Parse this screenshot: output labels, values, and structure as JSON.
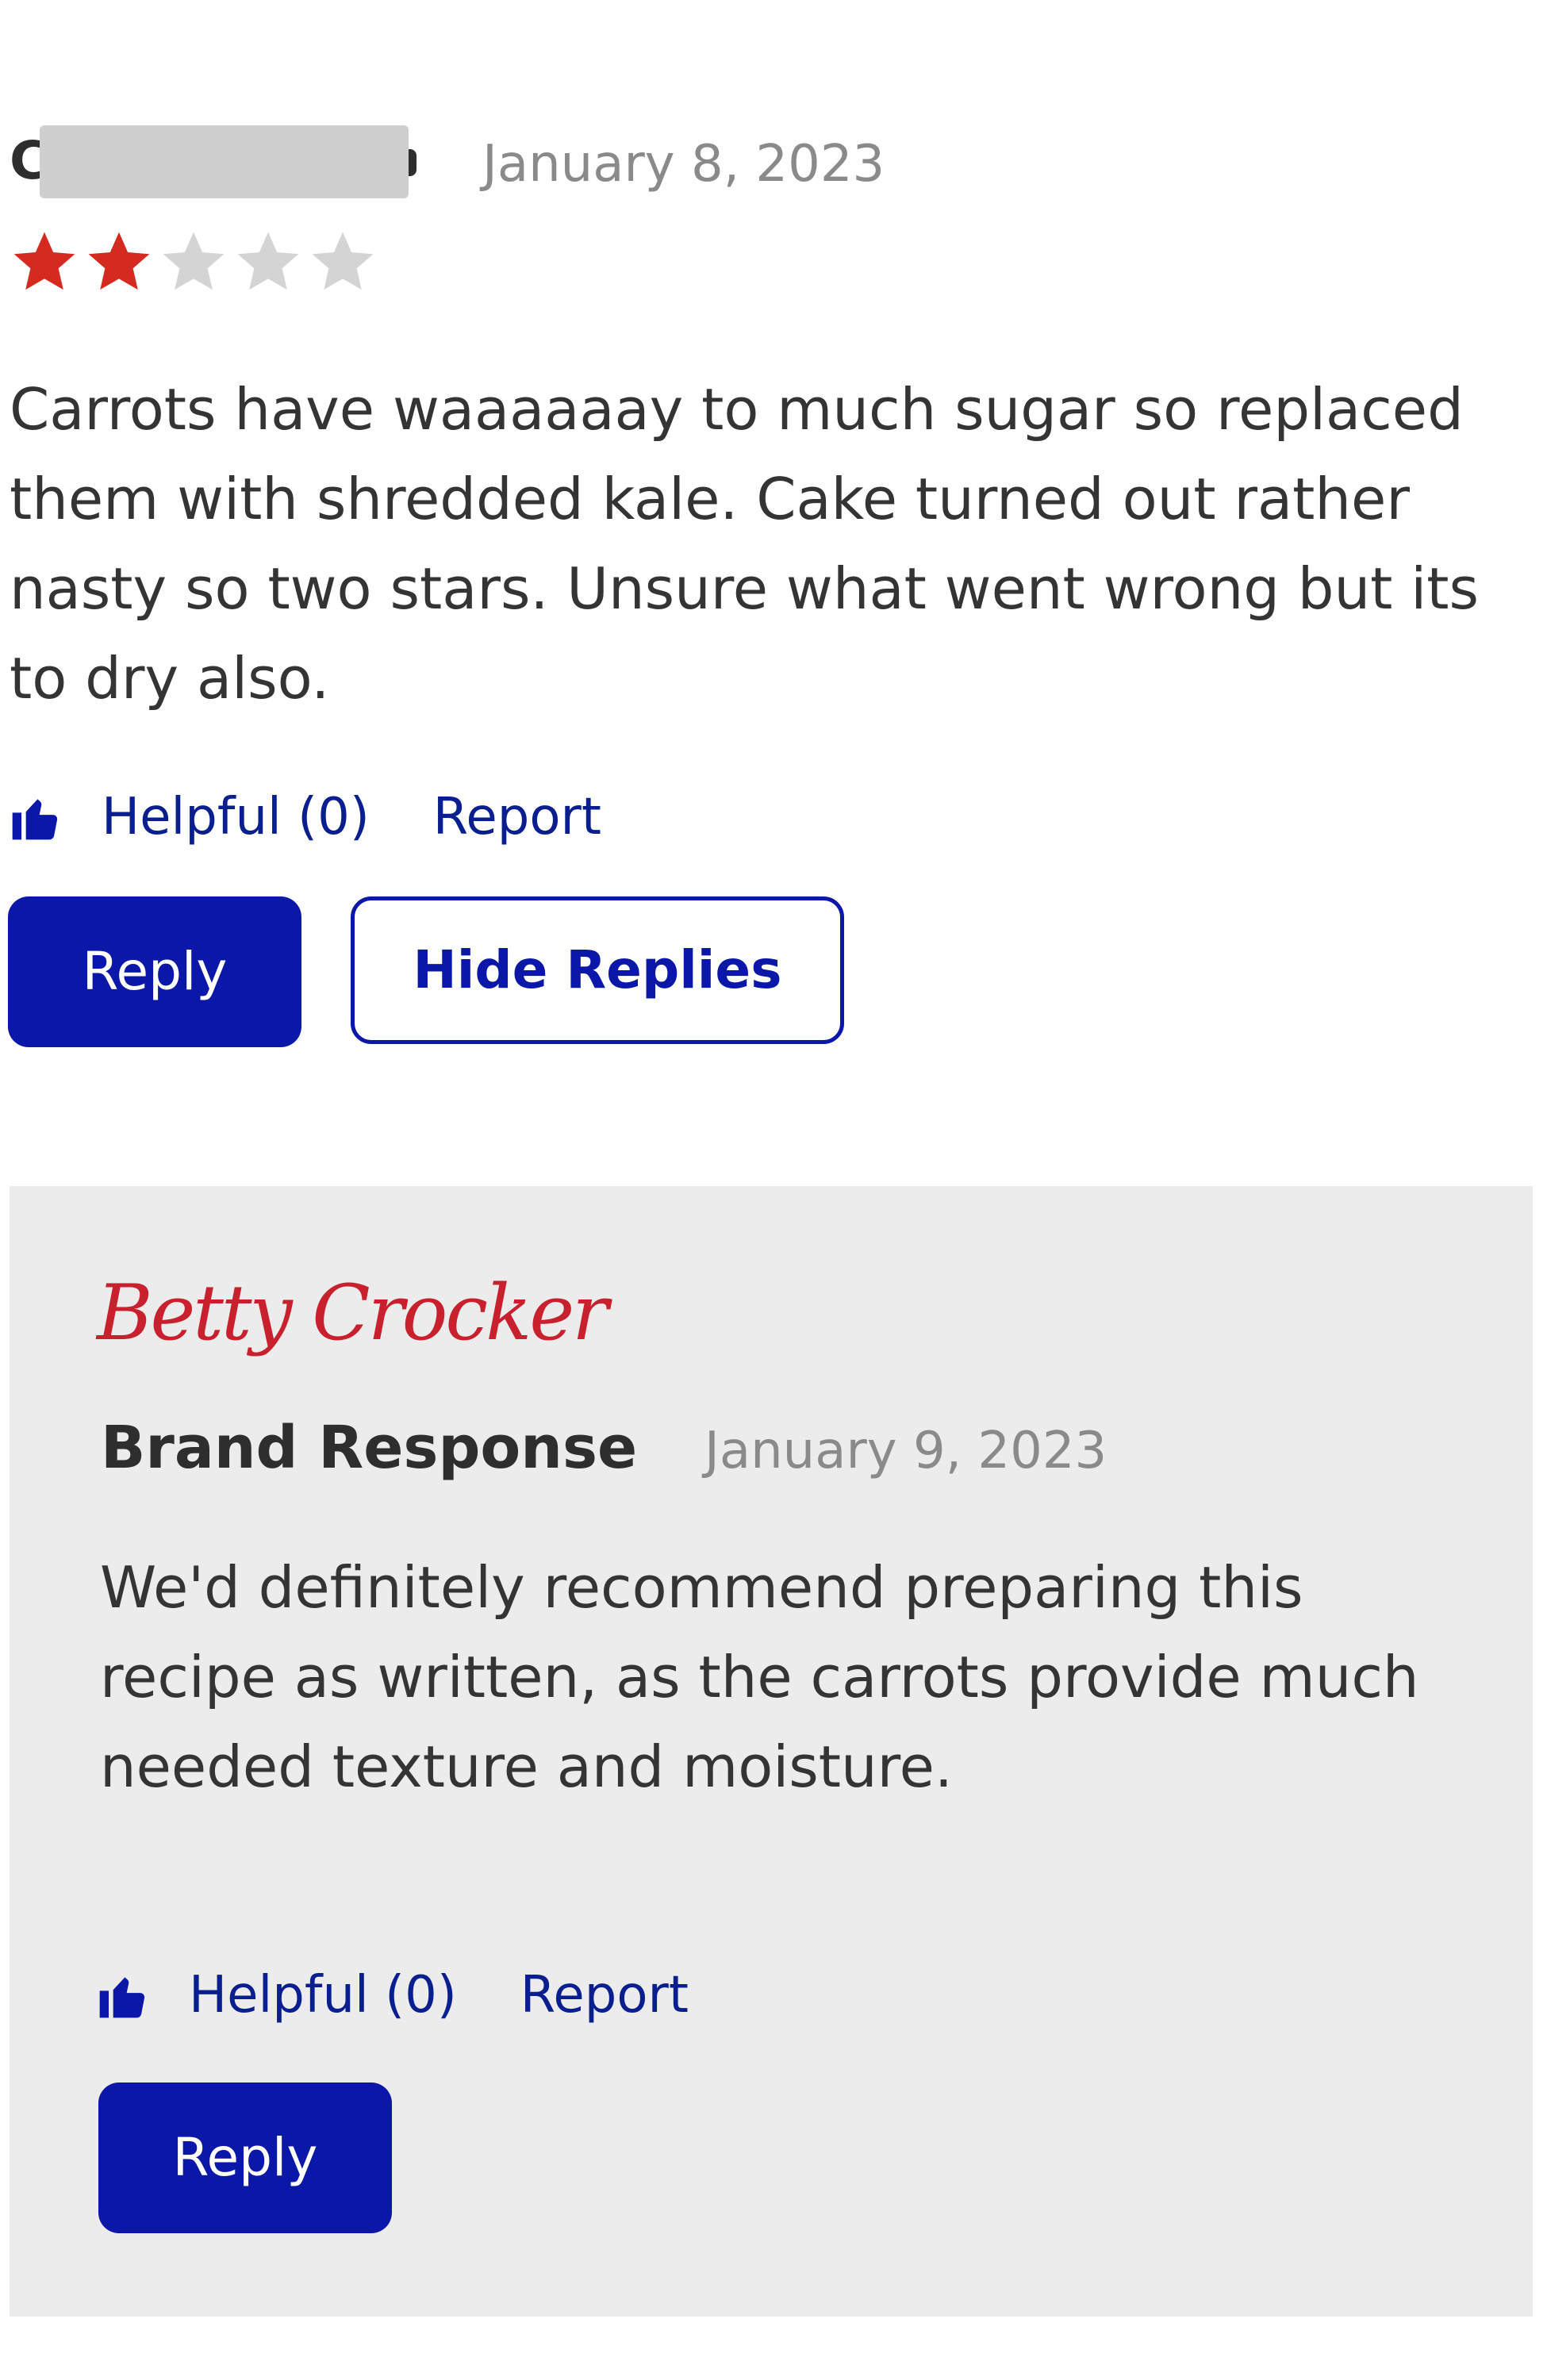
{
  "review": {
    "author_initial": "C",
    "date": "January 8, 2023",
    "rating": 2,
    "rating_max": 5,
    "body": "Carrots have waaaaaay to much sugar so replaced them with shredded kale. Cake turned out rather nasty so two stars. Unsure what went wrong but its to dry also.",
    "helpful_label": "Helpful (0)",
    "report_label": "Report",
    "reply_label": "Reply",
    "hide_replies_label": "Hide Replies"
  },
  "brand_response": {
    "logo_text": "Betty Crocker",
    "title": "Brand Response",
    "date": "January 9, 2023",
    "body": "We'd definitely recommend preparing this recipe as written, as the carrots provide much needed texture and moisture.",
    "helpful_label": "Helpful (0)",
    "report_label": "Report",
    "reply_label": "Reply"
  },
  "colors": {
    "star_filled": "#d42a1f",
    "star_empty": "#d4d4d4",
    "accent": "#0a17a8",
    "link": "#0a1f8f",
    "brand_red": "#c8202d",
    "panel_bg": "#ececec"
  },
  "icons": {
    "rating": "star-icon",
    "helpful": "thumbs-up-icon"
  }
}
